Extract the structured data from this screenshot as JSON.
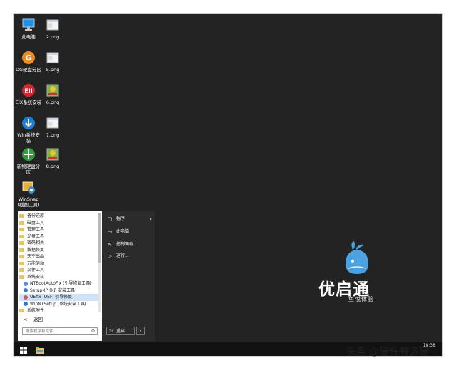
{
  "desktop": {
    "icons": [
      {
        "label": "此电脑",
        "icon": "computer-icon"
      },
      {
        "label": "2.png",
        "icon": "png-file-icon"
      },
      {
        "label": "DG硬盘分区",
        "icon": "diskgenius-icon"
      },
      {
        "label": "5.png",
        "icon": "png-file-icon"
      },
      {
        "label": "EIX系统安装",
        "icon": "eix-icon"
      },
      {
        "label": "6.png",
        "icon": "png-file-icon"
      },
      {
        "label": "Win系统安装",
        "icon": "win-install-icon"
      },
      {
        "label": "7.png",
        "icon": "png-file-icon"
      },
      {
        "label": "新物硬盘分区",
        "icon": "partition-icon"
      },
      {
        "label": "8.png",
        "icon": "png-file-icon"
      },
      {
        "label": "WinSnap (截图工具)",
        "icon": "winsnap-icon"
      }
    ]
  },
  "start_menu": {
    "programs": [
      {
        "label": "备份还原",
        "type": "folder"
      },
      {
        "label": "磁盘工具",
        "type": "folder"
      },
      {
        "label": "管理工具",
        "type": "folder"
      },
      {
        "label": "光盘工具",
        "type": "folder"
      },
      {
        "label": "密码相关",
        "type": "folder"
      },
      {
        "label": "数据恢复",
        "type": "folder"
      },
      {
        "label": "天空出品",
        "type": "folder"
      },
      {
        "label": "万能驱动",
        "type": "folder"
      },
      {
        "label": "文件工具",
        "type": "folder"
      },
      {
        "label": "系统安装",
        "type": "folder"
      },
      {
        "label": "NTBootAutoFix (引导修复工具)",
        "type": "app"
      },
      {
        "label": "SetupXP (XP 安装工具)",
        "type": "app"
      },
      {
        "label": "UEfix (UEFI 引导修复)",
        "type": "app",
        "selected": true
      },
      {
        "label": "WinNTSetup (系统安装工具)",
        "type": "app"
      },
      {
        "label": "系统附件",
        "type": "folder"
      }
    ],
    "back_label": "返回",
    "search_placeholder": "搜索程序和文件",
    "right_items": [
      {
        "label": "程序",
        "icon": "programs-icon",
        "has_submenu": true
      },
      {
        "label": "此电脑",
        "icon": "computer-icon"
      },
      {
        "label": "控制面板",
        "icon": "control-panel-icon"
      },
      {
        "label": "运行...",
        "icon": "run-icon"
      }
    ],
    "restart_label": "重启"
  },
  "taskbar": {
    "clock_time": "18:38",
    "icons": [
      "windows-start-icon",
      "file-explorer-icon"
    ]
  },
  "branding": {
    "title": "优启通",
    "subtitle": "鱼悦体验"
  },
  "watermark": "头条 @硬件有多硬",
  "colors": {
    "desktop_bg": "#232323",
    "accent_blue": "#4aa3e0",
    "folder_yellow": "#e9c25a"
  }
}
